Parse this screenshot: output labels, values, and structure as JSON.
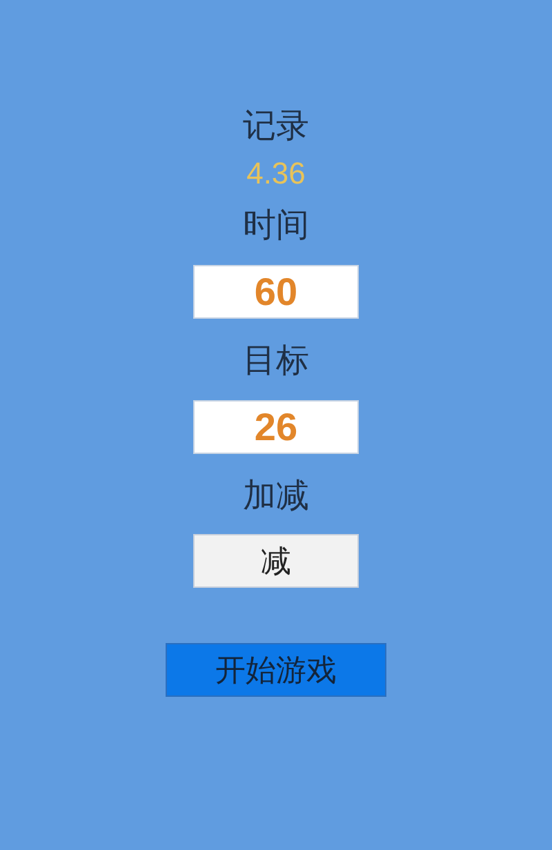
{
  "record": {
    "label": "记录",
    "value": "4.36"
  },
  "time": {
    "label": "时间",
    "value": "60"
  },
  "target": {
    "label": "目标",
    "value": "26"
  },
  "mode": {
    "label": "加减",
    "button": "减"
  },
  "start_button": "开始游戏"
}
